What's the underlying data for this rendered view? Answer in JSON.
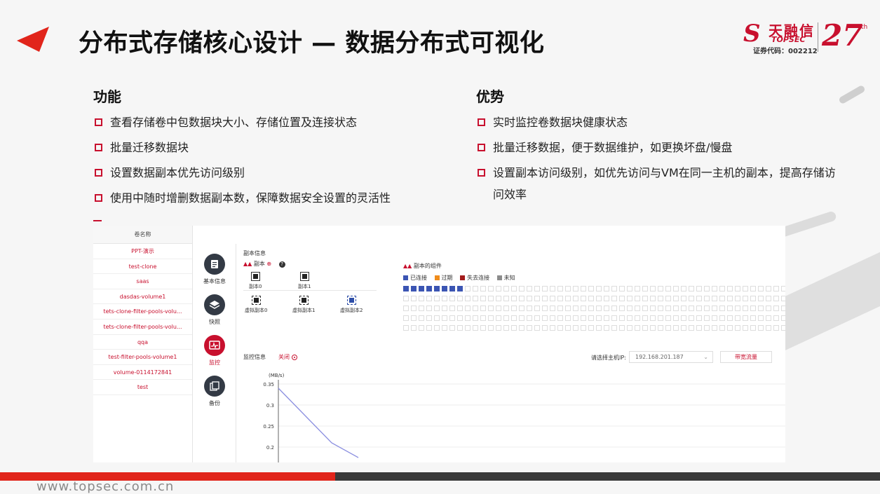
{
  "slide": {
    "title": "分布式存储核心设计 — 数据分布式可视化",
    "url": "www.topsec.com.cn"
  },
  "logo": {
    "brand_cn": "天融信",
    "brand_en": "TOPSEC",
    "stock_code": "证券代码：002212",
    "anniversary": "27",
    "anniversary_sup": "th"
  },
  "features": {
    "heading": "功能",
    "items": [
      "查看存储卷中包数据块大小、存储位置及连接状态",
      "批量迁移数据块",
      "设置数据副本优先访问级别",
      "使用中随时增删数据副本数，保障数据安全设置的灵活性"
    ]
  },
  "advantages": {
    "heading": "优势",
    "items": [
      "实时监控卷数据块健康状态",
      "批量迁移数据，便于数据维护，如更换坏盘/慢盘",
      "设置副本访问级别，如优先访问与VM在同一主机的副本，提高存储访问效率"
    ]
  },
  "app": {
    "volume_list": {
      "header": "卷名称",
      "items": [
        "PPT-演示",
        "test-clone",
        "saas",
        "dasdas-volume1",
        "tets-clone-filter-pools-volu...",
        "tets-clone-filter-pools-volu...",
        "qqa",
        "test-filter-pools-volume1",
        "volume-0114172841",
        "test"
      ]
    },
    "nav": {
      "items": [
        {
          "label": "基本信息",
          "icon": "document-icon"
        },
        {
          "label": "快照",
          "icon": "layers-icon"
        },
        {
          "label": "监控",
          "icon": "monitor-icon"
        },
        {
          "label": "备份",
          "icon": "backup-icon"
        }
      ],
      "active_index": 2
    },
    "replica_info": {
      "title": "副本信息",
      "replica_label": "副本",
      "replicas": [
        "副本0",
        "副本1"
      ],
      "virtual_replicas": [
        "虚拟副本0",
        "虚拟副本1",
        "虚拟副本2"
      ],
      "components_title": "副本的组件",
      "legend": [
        {
          "label": "已连接",
          "color": "#3b55b3"
        },
        {
          "label": "过期",
          "color": "#f08c1b"
        },
        {
          "label": "失去连接",
          "color": "#a31c1c"
        },
        {
          "label": "未知",
          "color": "#8c8c8c"
        }
      ],
      "connected_count": 8
    },
    "monitor": {
      "title": "监控信息",
      "toggle_label": "关闭",
      "host_ip_label": "请选择主机IP:",
      "host_ip_value": "192.168.201.187",
      "bandwidth_button": "带宽流量"
    }
  },
  "chart_data": {
    "type": "line",
    "ylabel": "(MB/s)",
    "yticks": [
      0.35,
      0.3,
      0.25,
      0.2
    ],
    "ylim": [
      0.2,
      0.35
    ],
    "series": [
      {
        "values": [
          0.34,
          0.275,
          0.21,
          0.175
        ]
      }
    ],
    "line_color": "#8b8fe0"
  }
}
